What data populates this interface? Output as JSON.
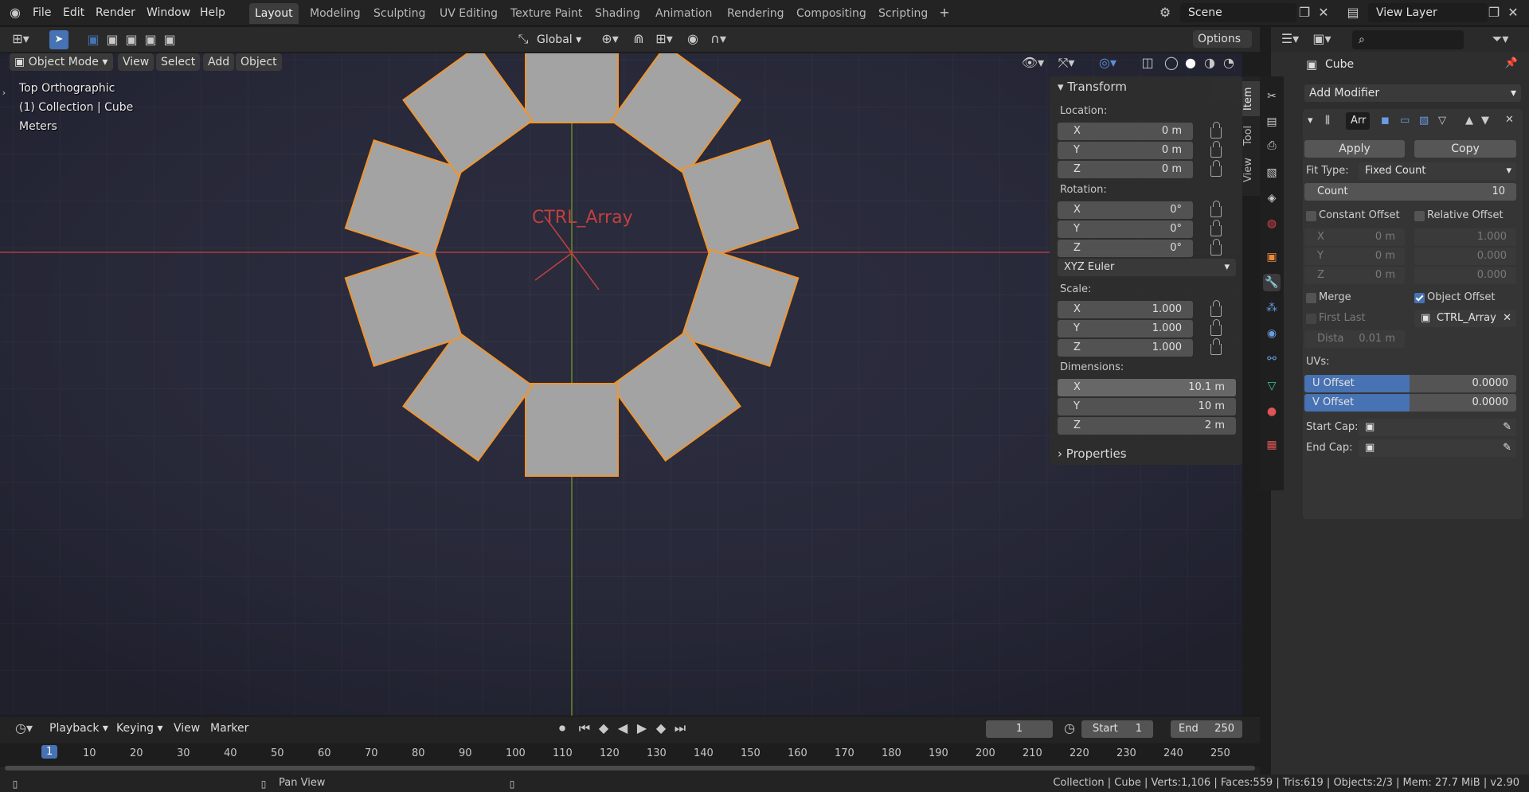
{
  "menu": {
    "file": "File",
    "edit": "Edit",
    "render": "Render",
    "window": "Window",
    "help": "Help"
  },
  "workspaces": [
    "Layout",
    "Modeling",
    "Sculpting",
    "UV Editing",
    "Texture Paint",
    "Shading",
    "Animation",
    "Rendering",
    "Compositing",
    "Scripting"
  ],
  "scene": {
    "name": "Scene",
    "view_layer": "View Layer"
  },
  "toolbar": {
    "orientation": "Global",
    "options": "Options"
  },
  "viewport_header": {
    "mode": "Object Mode",
    "view": "View",
    "select": "Select",
    "add": "Add",
    "object": "Object"
  },
  "overlay": {
    "view_name": "Top Orthographic",
    "collection": "(1) Collection | Cube",
    "units": "Meters",
    "empty_label": "CTRL_Array"
  },
  "npanel": {
    "transform": "Transform",
    "location": "Location:",
    "rotation": "Rotation:",
    "scale": "Scale:",
    "dimensions": "Dimensions:",
    "properties": "Properties",
    "loc": [
      {
        "a": "X",
        "v": "0 m"
      },
      {
        "a": "Y",
        "v": "0 m"
      },
      {
        "a": "Z",
        "v": "0 m"
      }
    ],
    "rot": [
      {
        "a": "X",
        "v": "0°"
      },
      {
        "a": "Y",
        "v": "0°"
      },
      {
        "a": "Z",
        "v": "0°"
      }
    ],
    "rot_mode": "XYZ Euler",
    "scl": [
      {
        "a": "X",
        "v": "1.000"
      },
      {
        "a": "Y",
        "v": "1.000"
      },
      {
        "a": "Z",
        "v": "1.000"
      }
    ],
    "dim": [
      {
        "a": "X",
        "v": "10.1 m"
      },
      {
        "a": "Y",
        "v": "10 m"
      },
      {
        "a": "Z",
        "v": "2 m"
      }
    ],
    "tabs": {
      "item": "Item",
      "tool": "Tool",
      "view": "View"
    }
  },
  "properties": {
    "object_name": "Cube",
    "add_modifier": "Add Modifier",
    "mod_name": "Arr",
    "apply": "Apply",
    "copy": "Copy",
    "fit_type_label": "Fit Type:",
    "fit_type": "Fixed Count",
    "count_label": "Count",
    "count": "10",
    "constant_offset": "Constant Offset",
    "relative_offset": "Relative Offset",
    "const_vals": [
      {
        "a": "X",
        "v": "0 m"
      },
      {
        "a": "Y",
        "v": "0 m"
      },
      {
        "a": "Z",
        "v": "0 m"
      }
    ],
    "rel_vals": [
      "1.000",
      "0.000",
      "0.000"
    ],
    "merge": "Merge",
    "object_offset": "Object Offset",
    "first_last": "First Last",
    "offset_object": "CTRL_Array",
    "distance_label": "Dista",
    "distance": "0.01 m",
    "uvs": "UVs:",
    "u_offset": "U Offset",
    "u_val": "0.0000",
    "v_offset": "V Offset",
    "v_val": "0.0000",
    "start_cap": "Start Cap:",
    "end_cap": "End Cap:"
  },
  "timeline": {
    "playback": "Playback",
    "keying": "Keying",
    "view": "View",
    "marker": "Marker",
    "current_frame": "1",
    "start_label": "Start",
    "start": "1",
    "end_label": "End",
    "end": "250",
    "ticks": [
      "1",
      "10",
      "20",
      "30",
      "40",
      "50",
      "60",
      "70",
      "80",
      "90",
      "100",
      "110",
      "120",
      "130",
      "140",
      "150",
      "160",
      "170",
      "180",
      "190",
      "200",
      "210",
      "220",
      "230",
      "240",
      "250"
    ]
  },
  "status": {
    "hint": "Pan View",
    "stats": "Collection | Cube | Verts:1,106 | Faces:559 | Tris:619 | Objects:2/3 | Mem: 27.7 MiB | v2.90"
  }
}
